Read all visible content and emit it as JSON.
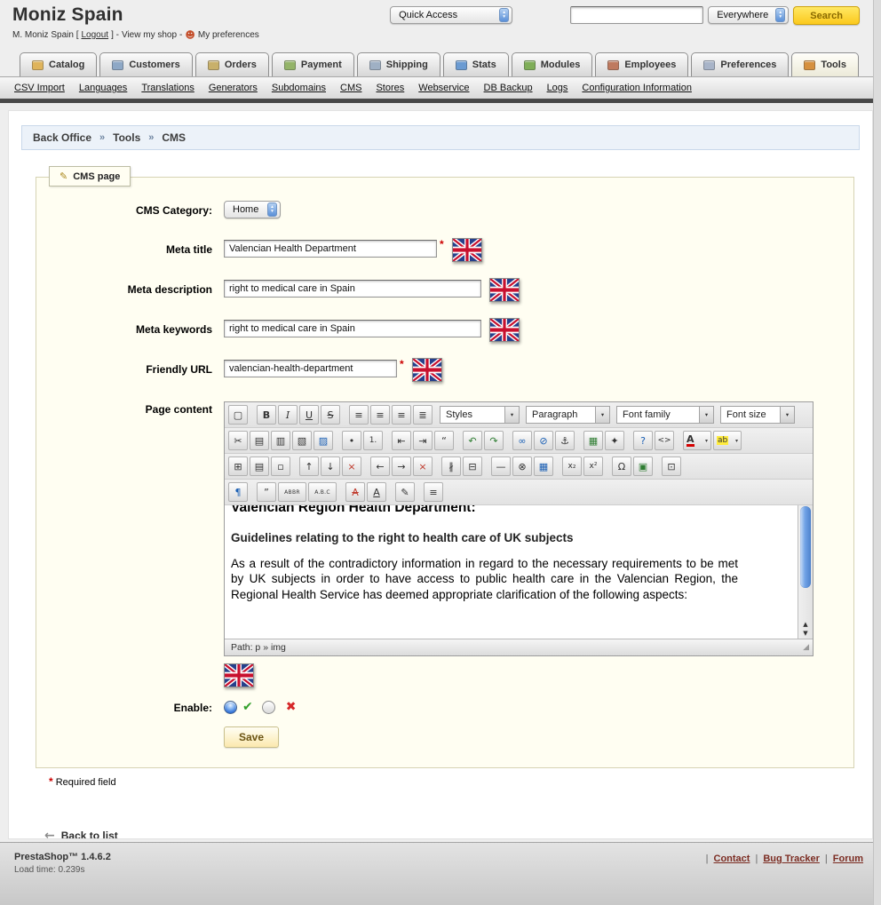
{
  "icons": {
    "select_up": "▴",
    "select_down": "▾"
  },
  "header": {
    "shop_name": "Moniz Spain",
    "user_prefix": "M. Moniz Spain [",
    "logout": "Logout",
    "sep1": "] -",
    "view_shop": "View my shop",
    "sep2": "-",
    "person_icon": "☻",
    "preferences": "My preferences",
    "quick_access": "Quick Access",
    "search_value": "",
    "search_scope": "Everywhere",
    "search_button": "Search"
  },
  "tabs": [
    {
      "name": "catalog",
      "label": "Catalog",
      "color": "#dfb45c"
    },
    {
      "name": "customers",
      "label": "Customers",
      "color": "#8ea8c6"
    },
    {
      "name": "orders",
      "label": "Orders",
      "color": "#c8b06a"
    },
    {
      "name": "payment",
      "label": "Payment",
      "color": "#94b469"
    },
    {
      "name": "shipping",
      "label": "Shipping",
      "color": "#9fb0c4"
    },
    {
      "name": "stats",
      "label": "Stats",
      "color": "#6b9bd2"
    },
    {
      "name": "modules",
      "label": "Modules",
      "color": "#7fae58"
    },
    {
      "name": "employees",
      "label": "Employees",
      "color": "#bf7a5f"
    },
    {
      "name": "preferences",
      "label": "Preferences",
      "color": "#a8b4c8"
    },
    {
      "name": "tools",
      "label": "Tools",
      "color": "#d6913f",
      "active": true
    }
  ],
  "submenu": [
    {
      "name": "csv-import",
      "label": "CSV Import"
    },
    {
      "name": "languages",
      "label": "Languages"
    },
    {
      "name": "translations",
      "label": "Translations"
    },
    {
      "name": "generators",
      "label": "Generators"
    },
    {
      "name": "subdomains",
      "label": "Subdomains"
    },
    {
      "name": "cms",
      "label": "CMS"
    },
    {
      "name": "stores",
      "label": "Stores"
    },
    {
      "name": "webservice",
      "label": "Webservice"
    },
    {
      "name": "db-backup",
      "label": "DB Backup"
    },
    {
      "name": "logs",
      "label": "Logs"
    },
    {
      "name": "configuration-information",
      "label": "Configuration Information"
    }
  ],
  "breadcrumb": {
    "separator": "»",
    "items": [
      "Back Office",
      "Tools",
      "CMS"
    ]
  },
  "form": {
    "legend_icon": "✎",
    "legend": "CMS page",
    "required_star": "*",
    "category": {
      "label": "CMS Category:",
      "value": "Home"
    },
    "meta_title": {
      "label": "Meta title",
      "value": "Valencian Health Department"
    },
    "meta_description": {
      "label": "Meta description",
      "value": "right to medical care in Spain"
    },
    "meta_keywords": {
      "label": "Meta keywords",
      "value": "right to medical care in Spain"
    },
    "friendly_url": {
      "label": "Friendly URL",
      "value": "valencian-health-department"
    },
    "page_content_label": "Page content",
    "enable": {
      "label": "Enable:",
      "yes_icon": "✔",
      "no_icon": "✖"
    },
    "save_button": "Save",
    "required_note": "Required field"
  },
  "editor": {
    "toolbar": {
      "selects": {
        "styles": "Styles",
        "paragraph": "Paragraph",
        "font_family": "Font family",
        "font_size": "Font size"
      },
      "row1": [
        {
          "name": "new-document",
          "glyph": "▢"
        },
        {
          "name": "bold",
          "glyph": "B",
          "cls": "b",
          "gap": true
        },
        {
          "name": "italic",
          "glyph": "I",
          "cls": "i"
        },
        {
          "name": "underline",
          "glyph": "U",
          "cls": "u"
        },
        {
          "name": "strikethrough",
          "glyph": "S",
          "cls": "s"
        },
        {
          "name": "align-left",
          "glyph": "≡",
          "gap": true
        },
        {
          "name": "align-center",
          "glyph": "≡"
        },
        {
          "name": "align-right",
          "glyph": "≡"
        },
        {
          "name": "align-justify",
          "glyph": "≣"
        }
      ],
      "row2": [
        {
          "name": "cut",
          "glyph": "✂"
        },
        {
          "name": "copy",
          "glyph": "▤"
        },
        {
          "name": "paste",
          "glyph": "▥"
        },
        {
          "name": "paste-as-text",
          "glyph": "▧"
        },
        {
          "name": "paste-from-word",
          "glyph": "▨",
          "cls": "blue"
        },
        {
          "name": "bullet-list",
          "glyph": "•",
          "gap": true
        },
        {
          "name": "numbered-list",
          "glyph": "1.",
          "cls": "tiny2"
        },
        {
          "name": "outdent",
          "glyph": "⇤",
          "gap": true
        },
        {
          "name": "indent",
          "glyph": "⇥"
        },
        {
          "name": "blockquote",
          "glyph": "“"
        },
        {
          "name": "undo",
          "glyph": "↶",
          "cls": "green",
          "gap": true
        },
        {
          "name": "redo",
          "glyph": "↷",
          "cls": "green"
        },
        {
          "name": "insert-link",
          "glyph": "∞",
          "cls": "blue",
          "gap": true
        },
        {
          "name": "remove-link",
          "glyph": "⊘",
          "cls": "blue"
        },
        {
          "name": "anchor",
          "glyph": "⚓"
        },
        {
          "name": "insert-image",
          "glyph": "▦",
          "cls": "green",
          "gap": true
        },
        {
          "name": "cleanup-code",
          "glyph": "✦"
        },
        {
          "name": "help",
          "glyph": "?",
          "cls": "blue",
          "gap": true
        },
        {
          "name": "source-code",
          "glyph": "<>",
          "cls": "tiny2"
        },
        {
          "name": "text-color",
          "glyph": "A",
          "cls": "fore",
          "split": true,
          "gap": true
        },
        {
          "name": "background-color",
          "glyph": "ab",
          "cls": "back",
          "split": true
        }
      ],
      "row3": [
        {
          "name": "insert-table",
          "glyph": "⊞"
        },
        {
          "name": "table-row-properties",
          "glyph": "▤"
        },
        {
          "name": "table-cell-properties",
          "glyph": "▫"
        },
        {
          "name": "insert-row-before",
          "glyph": "↑",
          "gap": true
        },
        {
          "name": "insert-row-after",
          "glyph": "↓"
        },
        {
          "name": "delete-row",
          "glyph": "×",
          "cls": "red"
        },
        {
          "name": "insert-column-before",
          "glyph": "←",
          "gap": true
        },
        {
          "name": "insert-column-after",
          "glyph": "→"
        },
        {
          "name": "delete-column",
          "glyph": "×",
          "cls": "red"
        },
        {
          "name": "split-cells",
          "glyph": "∦",
          "gap": true
        },
        {
          "name": "merge-cells",
          "glyph": "⊟"
        },
        {
          "name": "horizontal-rule",
          "glyph": "—",
          "gap": true
        },
        {
          "name": "remove-formatting",
          "glyph": "⊗"
        },
        {
          "name": "visual-aid",
          "glyph": "▦",
          "cls": "blue"
        },
        {
          "name": "subscript",
          "glyph": "x₂",
          "cls": "tiny2",
          "gap": true
        },
        {
          "name": "superscript",
          "glyph": "x²",
          "cls": "tiny2"
        },
        {
          "name": "special-character",
          "glyph": "Ω",
          "gap": true
        },
        {
          "name": "embed-media",
          "glyph": "▣",
          "cls": "green"
        },
        {
          "name": "insert-template",
          "glyph": "⊡",
          "gap": true
        }
      ],
      "row4": [
        {
          "name": "visual-characters",
          "glyph": "¶",
          "cls": "blue"
        },
        {
          "name": "citation",
          "glyph": "”",
          "gap": true
        },
        {
          "name": "abbreviation",
          "glyph": "ABBR",
          "cls": "tiny",
          "wide": true
        },
        {
          "name": "acronym",
          "glyph": "A.B.C",
          "cls": "tiny",
          "wide": true
        },
        {
          "name": "deleted-text",
          "glyph": "A",
          "cls": "del",
          "gap": true
        },
        {
          "name": "inserted-text",
          "glyph": "A",
          "cls": "ins"
        },
        {
          "name": "insert-attributes",
          "glyph": "✎",
          "gap": true
        },
        {
          "name": "style-properties",
          "glyph": "≡",
          "gap": true
        }
      ]
    },
    "content": {
      "title": "Valencian Region Health Department:",
      "subtitle": "Guidelines relating to the right to health care of UK subjects",
      "paragraph": "As a result of the contradictory information in regard to the necessary requirements to be met by UK subjects in order to have access to public health care in the Valencian Region, the Regional Health Service has deemed appropriate clarification of the following aspects:"
    },
    "scrollbar": {
      "up": "▲",
      "down": "▼"
    },
    "path": "Path: p » img",
    "resize_grip_icon": "◢"
  },
  "back_to_list": {
    "icon": "←",
    "label": "Back to list"
  },
  "footer": {
    "brand": "PrestaShop™ 1.4.6.2",
    "load_time": "Load time: 0.239s",
    "separator": "|",
    "links": [
      {
        "name": "contact",
        "label": "Contact"
      },
      {
        "name": "bug-tracker",
        "label": "Bug Tracker"
      },
      {
        "name": "forum",
        "label": "Forum"
      }
    ]
  }
}
